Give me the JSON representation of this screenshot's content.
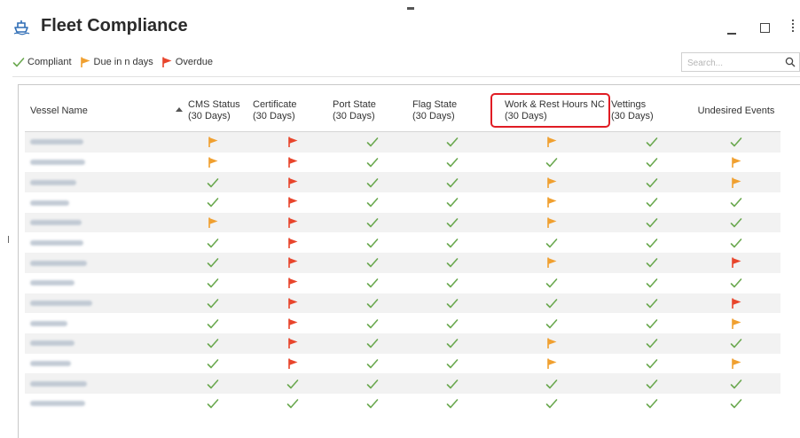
{
  "window": {
    "title": "Fleet Compliance"
  },
  "legend": {
    "compliant": "Compliant",
    "due": "Due in n days",
    "overdue": "Overdue"
  },
  "search": {
    "placeholder": "Search..."
  },
  "colors": {
    "compliant": "#6aa84f",
    "due": "#f0a030",
    "overdue": "#e8452c",
    "highlight": "#e01c24"
  },
  "table": {
    "columns": [
      {
        "line1": "Vessel Name",
        "line2": ""
      },
      {
        "line1": "CMS Status",
        "line2": "(30 Days)"
      },
      {
        "line1": "Certificate",
        "line2": "(30 Days)"
      },
      {
        "line1": "Port State",
        "line2": "(30 Days)"
      },
      {
        "line1": "Flag State",
        "line2": "(30 Days)"
      },
      {
        "line1": "Work & Rest Hours NC",
        "line2": "(30 Days)"
      },
      {
        "line1": "Vettings",
        "line2": "(30 Days)"
      },
      {
        "line1": "Undesired Events",
        "line2": ""
      }
    ],
    "sorted_column": "CMS Status",
    "highlighted_column": "Work & Rest Hours NC",
    "rows": [
      {
        "status": [
          "due",
          "overdue",
          "compliant",
          "compliant",
          "due",
          "compliant",
          "compliant"
        ]
      },
      {
        "status": [
          "due",
          "overdue",
          "compliant",
          "compliant",
          "compliant",
          "compliant",
          "due"
        ]
      },
      {
        "status": [
          "compliant",
          "overdue",
          "compliant",
          "compliant",
          "due",
          "compliant",
          "due"
        ]
      },
      {
        "status": [
          "compliant",
          "overdue",
          "compliant",
          "compliant",
          "due",
          "compliant",
          "compliant"
        ]
      },
      {
        "status": [
          "due",
          "overdue",
          "compliant",
          "compliant",
          "due",
          "compliant",
          "compliant"
        ]
      },
      {
        "status": [
          "compliant",
          "overdue",
          "compliant",
          "compliant",
          "compliant",
          "compliant",
          "compliant"
        ]
      },
      {
        "status": [
          "compliant",
          "overdue",
          "compliant",
          "compliant",
          "due",
          "compliant",
          "overdue"
        ]
      },
      {
        "status": [
          "compliant",
          "overdue",
          "compliant",
          "compliant",
          "compliant",
          "compliant",
          "compliant"
        ]
      },
      {
        "status": [
          "compliant",
          "overdue",
          "compliant",
          "compliant",
          "compliant",
          "compliant",
          "overdue"
        ]
      },
      {
        "status": [
          "compliant",
          "overdue",
          "compliant",
          "compliant",
          "compliant",
          "compliant",
          "due"
        ]
      },
      {
        "status": [
          "compliant",
          "overdue",
          "compliant",
          "compliant",
          "due",
          "compliant",
          "compliant"
        ]
      },
      {
        "status": [
          "compliant",
          "overdue",
          "compliant",
          "compliant",
          "due",
          "compliant",
          "due"
        ]
      },
      {
        "status": [
          "compliant",
          "compliant",
          "compliant",
          "compliant",
          "compliant",
          "compliant",
          "compliant"
        ]
      },
      {
        "status": [
          "compliant",
          "compliant",
          "compliant",
          "compliant",
          "compliant",
          "compliant",
          "compliant"
        ]
      }
    ]
  }
}
